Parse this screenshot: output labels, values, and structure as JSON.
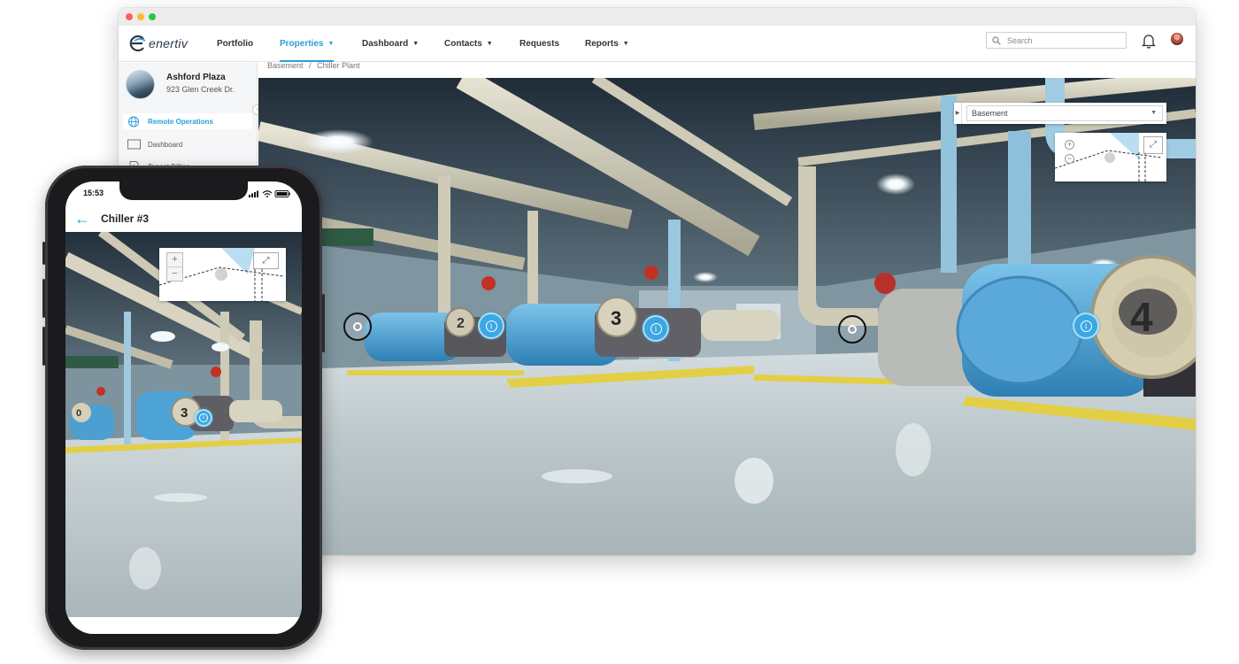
{
  "app": {
    "brand": "enertiv"
  },
  "nav": {
    "items": [
      {
        "label": "Portfolio",
        "dropdown": false,
        "active": false
      },
      {
        "label": "Properties",
        "dropdown": true,
        "active": true
      },
      {
        "label": "Dashboard",
        "dropdown": true,
        "active": false
      },
      {
        "label": "Contacts",
        "dropdown": true,
        "active": false
      },
      {
        "label": "Requests",
        "dropdown": false,
        "active": false
      },
      {
        "label": "Reports",
        "dropdown": true,
        "active": false
      }
    ],
    "search_placeholder": "Search"
  },
  "property": {
    "name": "Ashford Plaza",
    "address": "923 Glen Creek Dr."
  },
  "sidebar": {
    "items": [
      {
        "label": "Remote Operations",
        "icon": "globe-icon",
        "active": true
      },
      {
        "label": "Dashboard",
        "icon": "monitor-icon",
        "active": false
      },
      {
        "label": "Tenant Billing",
        "icon": "dollar-document-icon",
        "active": false
      }
    ]
  },
  "breadcrumb": {
    "parts": [
      "Basement",
      "/",
      "Chiller Plant"
    ]
  },
  "viewer": {
    "floor_selected": "Basement",
    "chiller_labels": [
      "2",
      "3",
      "4"
    ]
  },
  "phone": {
    "time": "15:53",
    "title": "Chiller #3",
    "chiller_label": "3"
  },
  "colors": {
    "accent": "#2a9fd8",
    "hotspot": "#3aa8e4",
    "chiller_body": "#4fa6d8",
    "floor": "#c9d3d6",
    "marking": "#e9d44a"
  }
}
